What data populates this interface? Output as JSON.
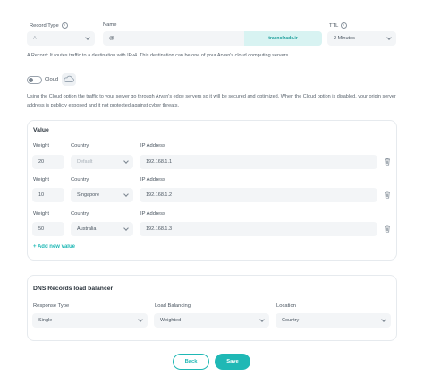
{
  "record": {
    "type_label": "Record Type",
    "type_value": "A",
    "name_label": "Name",
    "name_value": "@",
    "name_suffix": "trasnolzade.ir",
    "ttl_label": "TTL",
    "ttl_value": "2 Minutes",
    "info_glyph": "i",
    "description": "A Record: It routes traffic to a destination with IPv4. This destination can be one of your Arvan's cloud computing servers."
  },
  "cloud": {
    "label": "Cloud",
    "enabled": false,
    "icon": "cloud-icon",
    "description_line1": "Using the Cloud option the traffic to your server go through Arvan's edge servers so it will be secured and optimized. When the Cloud option is disabled, your origin server",
    "description_line2": "address is publicly exposed and it not protected against cyber threats."
  },
  "value_section": {
    "title": "Value",
    "weight_label": "Weight",
    "country_label": "Country",
    "ip_label": "IP Address",
    "rows": [
      {
        "weight": "20",
        "country": "Default",
        "ip": "192.168.1.1"
      },
      {
        "weight": "10",
        "country": "Singapore",
        "ip": "192.168.1.2"
      },
      {
        "weight": "50",
        "country": "Australia",
        "ip": "192.168.1.3"
      }
    ],
    "add_label": "+ Add new value"
  },
  "lb_section": {
    "title": "DNS Records load balancer",
    "response_label": "Response Type",
    "response_value": "Single",
    "balancing_label": "Load Balancing",
    "balancing_value": "Weighted",
    "location_label": "Location",
    "location_value": "Country"
  },
  "actions": {
    "back": "Back",
    "save": "Save"
  },
  "colors": {
    "accent": "#1fb8b5",
    "accent_light": "#d8f3f2",
    "field_bg": "#f3f5f7"
  }
}
